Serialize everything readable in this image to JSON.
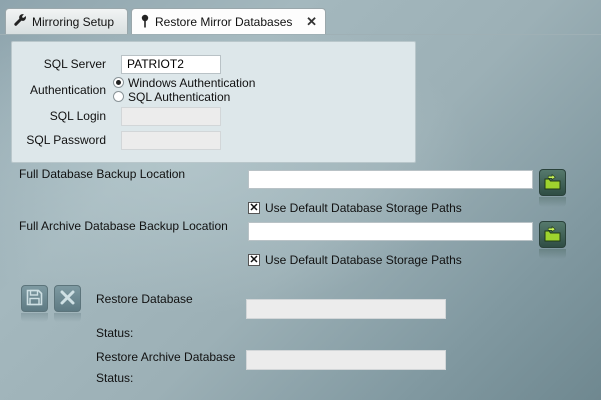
{
  "tabs": [
    {
      "label": "Mirroring Setup",
      "icon": "wrench-icon",
      "active": false
    },
    {
      "label": "Restore Mirror Databases",
      "icon": "pin-icon",
      "active": true,
      "close": "✕"
    }
  ],
  "login": {
    "server_label": "SQL Server",
    "server_value": "PATRIOT2",
    "auth_label": "Authentication",
    "auth_options": [
      "Windows Authentication",
      "SQL Authentication"
    ],
    "auth_selected": "Windows Authentication",
    "login_label": "SQL Login",
    "login_value": "",
    "password_label": "SQL Password",
    "password_value": ""
  },
  "backup": {
    "full_label": "Full Database Backup Location",
    "full_value": "",
    "full_default_label": "Use Default Database Storage Paths",
    "full_default_checked": true,
    "archive_label": "Full Archive Database Backup Location",
    "archive_value": "",
    "archive_default_label": "Use Default Database Storage Paths",
    "archive_default_checked": true
  },
  "restore": {
    "restore_db_label": "Restore Database",
    "restore_db_status_label": "Status:",
    "restore_archive_label": "Restore Archive Database",
    "restore_archive_status_label": "Status:"
  },
  "check_mark": "✕",
  "colors": {
    "panel_bg": "#dde7ea",
    "folder_button": "#3e6055",
    "folder_icon": "#9fd32e"
  }
}
